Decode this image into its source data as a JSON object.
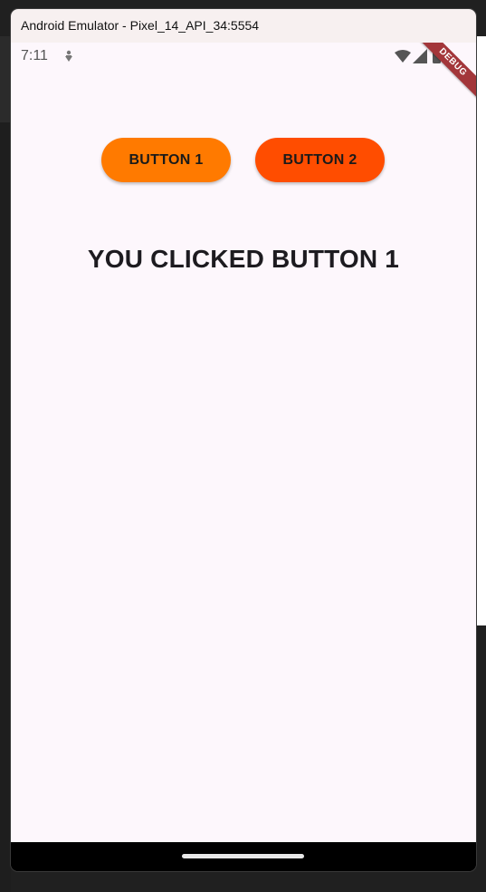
{
  "window": {
    "title": "Android Emulator - Pixel_14_API_34:5554"
  },
  "status_bar": {
    "time": "7:11",
    "icons": [
      "notification-icon",
      "wifi-icon",
      "signal-icon",
      "battery-icon"
    ]
  },
  "debug_banner": {
    "label": "DEBUG"
  },
  "buttons": [
    {
      "label": "BUTTON 1",
      "color": "#ff7a00"
    },
    {
      "label": "BUTTON 2",
      "color": "#ff4d00"
    }
  ],
  "result": {
    "text": "YOU CLICKED BUTTON 1"
  },
  "colors": {
    "screen_background": "#fdf7fc",
    "debug_banner": "#a3363a"
  }
}
